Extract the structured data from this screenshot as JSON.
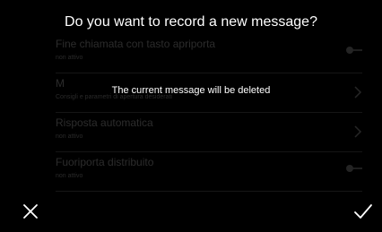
{
  "dialog": {
    "title": "Do you want to record a new message?",
    "message": "The current message will be deleted",
    "cancel_icon": "close-icon",
    "confirm_icon": "check-icon"
  },
  "settings": {
    "items": [
      {
        "title": "Fine chiamata con tasto apriporta",
        "subtitle": "non attivo",
        "control": "toggle",
        "toggle_on": false
      },
      {
        "title": "M",
        "subtitle": "Consigli e parametri di apertura desiderati",
        "control": "chevron"
      },
      {
        "title": "Risposta automatica",
        "subtitle": "non attivo",
        "control": "chevron"
      },
      {
        "title": "Fuoriporta distribuito",
        "subtitle": "non attivo",
        "control": "toggle",
        "toggle_on": false
      }
    ]
  },
  "colors": {
    "background": "#000000",
    "text": "#ffffff",
    "dimmed_text": "#2c2c2c"
  }
}
